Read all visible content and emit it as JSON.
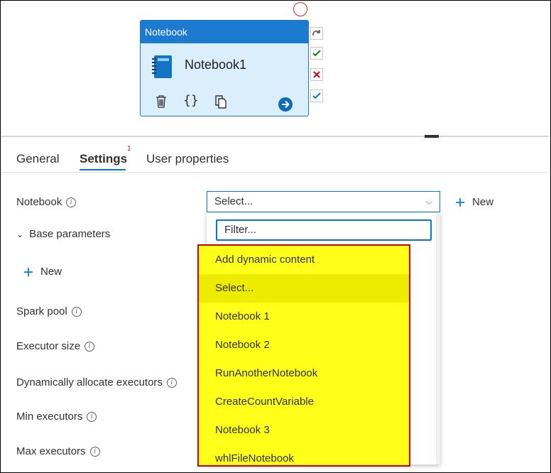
{
  "canvas": {
    "activity": {
      "type_label": "Notebook",
      "name": "Notebook1",
      "actions": [
        "delete-icon",
        "code-icon",
        "copy-icon",
        "go-arrow-icon"
      ]
    },
    "side_icons": [
      "redo-icon",
      "success-check-icon",
      "failure-x-icon",
      "completion-check-icon"
    ]
  },
  "tabs": {
    "general": "General",
    "settings": "Settings",
    "settings_badge": "1",
    "user_properties": "User properties"
  },
  "form": {
    "notebook_label": "Notebook",
    "notebook_select_value": "Select...",
    "new_label": "New",
    "base_parameters_label": "Base parameters",
    "base_new_label": "New",
    "spark_pool_label": "Spark pool",
    "executor_size_label": "Executor size",
    "dynamic_alloc_label": "Dynamically allocate executors",
    "min_executors_label": "Min executors",
    "max_executors_label": "Max executors"
  },
  "dropdown": {
    "filter_placeholder": "Filter...",
    "options": [
      "Add dynamic content",
      "Select...",
      "Notebook 1",
      "Notebook 2",
      "RunAnotherNotebook",
      "CreateCountVariable",
      "Notebook 3",
      "whlFileNotebook"
    ],
    "hover_index": 1
  },
  "colors": {
    "accent": "#0078d4",
    "activity_header": "#1c7ad1",
    "highlight": "#ffff00",
    "highlight_border": "#d00000"
  }
}
